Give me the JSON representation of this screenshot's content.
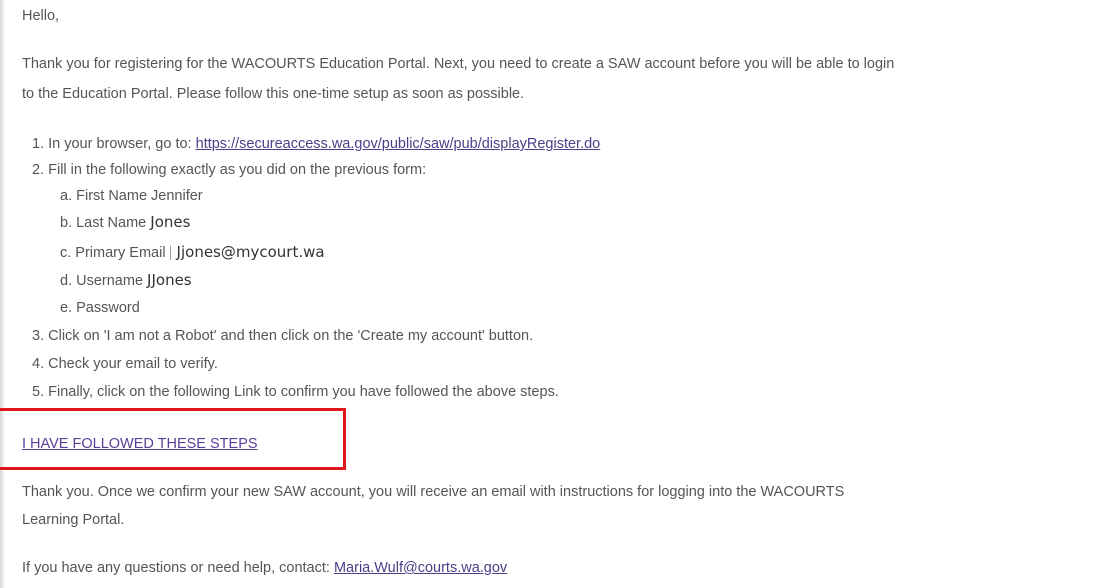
{
  "email": {
    "greeting": "Hello,",
    "intro_line1": "Thank you for registering for the WACOURTS Education Portal. Next, you need to create a SAW account before you will be able to login",
    "intro_line2": "to the Education Portal. Please follow this one-time setup as soon as possible.",
    "steps": {
      "step1_prefix": "1. In your browser, go to: ",
      "step1_link": "https://secureaccess.wa.gov/public/saw/pub/displayRegister.do",
      "step2": "2. Fill in the following exactly as you did on the previous form:",
      "sub_a_label": "a. First Name ",
      "sub_a_value": "Jennifer",
      "sub_b_label": "b. Last Name ",
      "sub_b_value": "Jones",
      "sub_c_label": "c. Primary Email",
      "sub_c_value": "Jjones@mycourt.wa",
      "sub_d_label": "d. Username ",
      "sub_d_value": "JJones",
      "sub_e_label": "e. Password",
      "step3": "3. Click on 'I am not a Robot' and then click on the 'Create my account' button.",
      "step4": "4. Check your email to verify.",
      "step5": "5. Finally, click on the following Link to confirm you have followed the above steps."
    },
    "confirm_link": "I HAVE FOLLOWED THESE STEPS",
    "thanks_line1": "Thank you. Once we confirm your new SAW account, you will receive an email with instructions for logging into the WACOURTS",
    "thanks_line2": "Learning Portal.",
    "contact_prefix": "If you have any questions or need help, contact: ",
    "contact_email": "Maria.Wulf@courts.wa.gov"
  },
  "colors": {
    "text": "#555555",
    "link": "#4f3c8a",
    "highlight": "#e0161c"
  }
}
